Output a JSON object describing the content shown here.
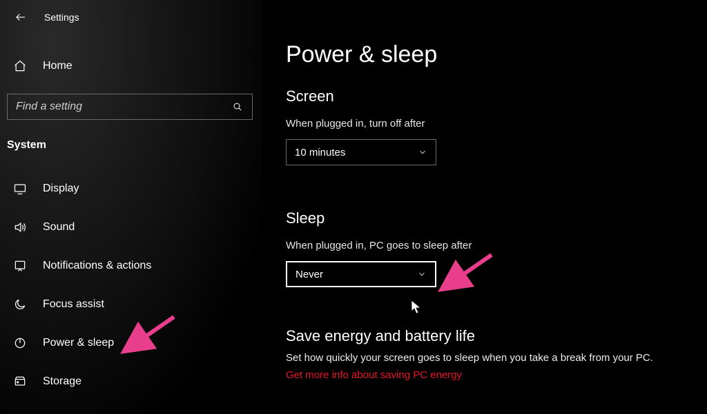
{
  "window": {
    "title": "Settings"
  },
  "sidebar": {
    "home_label": "Home",
    "search_placeholder": "Find a setting",
    "section": "System",
    "items": [
      {
        "label": "Display"
      },
      {
        "label": "Sound"
      },
      {
        "label": "Notifications & actions"
      },
      {
        "label": "Focus assist"
      },
      {
        "label": "Power & sleep"
      },
      {
        "label": "Storage"
      }
    ]
  },
  "page": {
    "title": "Power & sleep",
    "screen": {
      "heading": "Screen",
      "label": "When plugged in, turn off after",
      "value": "10 minutes"
    },
    "sleep": {
      "heading": "Sleep",
      "label": "When plugged in, PC goes to sleep after",
      "value": "Never"
    },
    "save": {
      "heading": "Save energy and battery life",
      "desc": "Set how quickly your screen goes to sleep when you take a break from your PC.",
      "link": "Get more info about saving PC energy"
    }
  },
  "annotations": {
    "arrow_color": "#e83e8c"
  }
}
